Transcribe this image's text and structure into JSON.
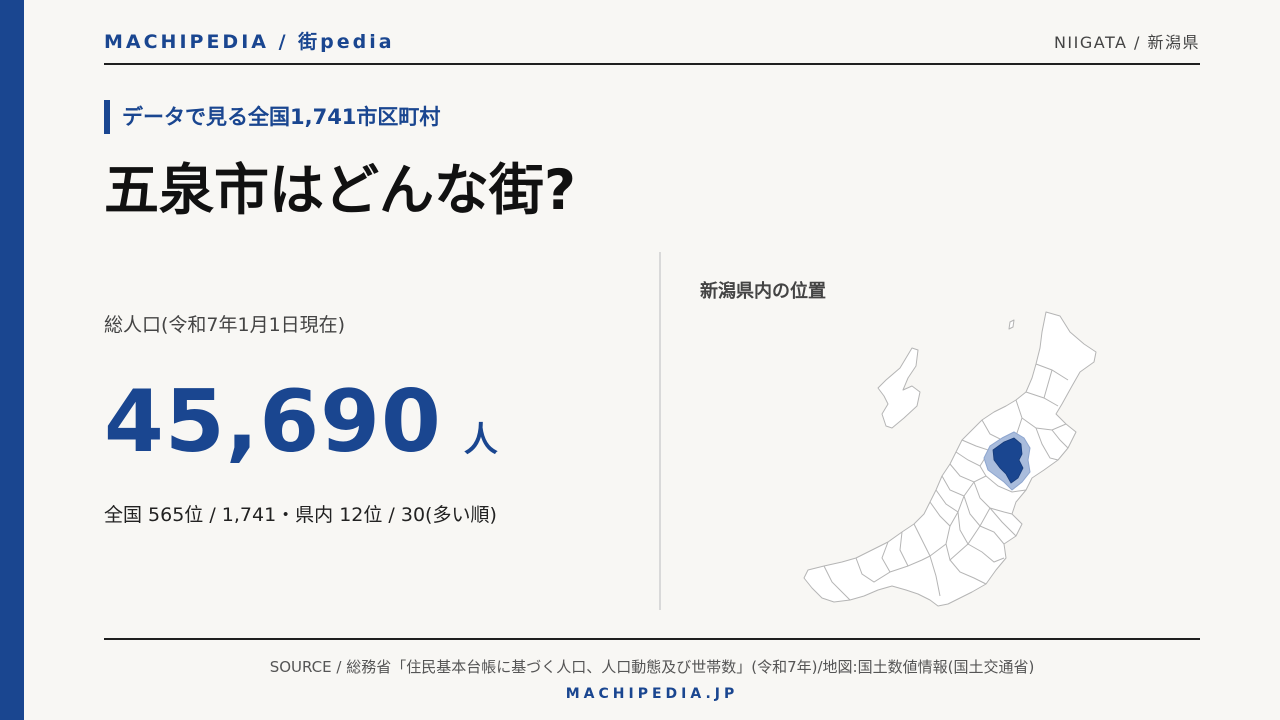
{
  "header": {
    "brand": "MACHIPEDIA / 街pedia",
    "region": "NIIGATA / 新潟県"
  },
  "hero": {
    "kicker": "データで見る全国1,741市区町村",
    "headline": "五泉市はどんな街?"
  },
  "population": {
    "label": "総人口(令和7年1月1日現在)",
    "value": "45,690",
    "unit": "人",
    "ranking": "全国 565位 / 1,741・県内 12位 / 30(多い順)"
  },
  "map": {
    "title": "新潟県内の位置"
  },
  "footer": {
    "source": "SOURCE / 総務省「住民基本台帳に基づく人口、人口動態及び世帯数」(令和7年)/地図:国土数値情報(国土交通省)",
    "site": "MACHIPEDIA.JP"
  },
  "colors": {
    "accent": "#1a4690",
    "highlight_fill": "#1a4690",
    "highlight_halo": "#a9bcdc",
    "map_fill": "#ffffff",
    "map_stroke": "#b5b5b5"
  }
}
